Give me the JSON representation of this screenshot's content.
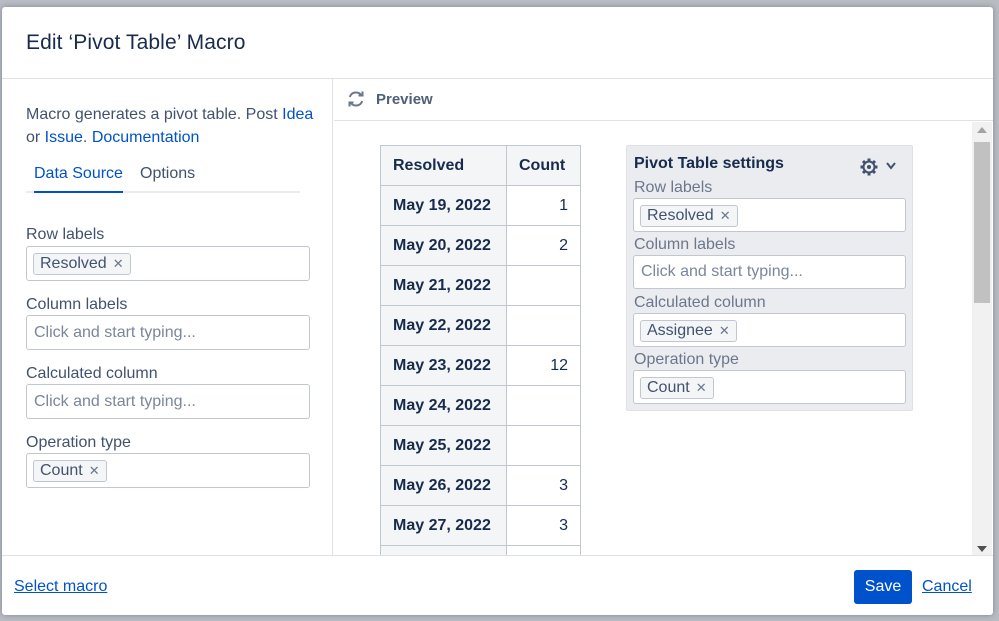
{
  "dialog": {
    "title": "Edit ‘Pivot Table’ Macro"
  },
  "left": {
    "desc_text1": "Macro generates a pivot table. Post ",
    "desc_link_idea": "Idea",
    "desc_or": "or ",
    "desc_link_issue": "Issue",
    "desc_dot": ". ",
    "desc_link_doc": "Documentation",
    "tabs": [
      "Data Source",
      "Options"
    ],
    "fields": {
      "row_labels": {
        "label": "Row labels",
        "tag": "Resolved"
      },
      "column_labels": {
        "label": "Column labels",
        "placeholder": "Click and start typing..."
      },
      "calculated_column": {
        "label": "Calculated column",
        "placeholder": "Click and start typing..."
      },
      "operation_type": {
        "label": "Operation type",
        "tag": "Count"
      }
    }
  },
  "preview": {
    "label": "Preview",
    "table": {
      "headers": [
        "Resolved",
        "Count"
      ],
      "rows": [
        {
          "date": "May 19, 2022",
          "count": "1"
        },
        {
          "date": "May 20, 2022",
          "count": "2"
        },
        {
          "date": "May 21, 2022",
          "count": ""
        },
        {
          "date": "May 22, 2022",
          "count": ""
        },
        {
          "date": "May 23, 2022",
          "count": "12"
        },
        {
          "date": "May 24, 2022",
          "count": ""
        },
        {
          "date": "May 25, 2022",
          "count": ""
        },
        {
          "date": "May 26, 2022",
          "count": "3"
        },
        {
          "date": "May 27, 2022",
          "count": "3"
        },
        {
          "date": "",
          "count": ""
        }
      ]
    },
    "settings": {
      "title": "Pivot Table settings",
      "row_labels": {
        "label": "Row labels",
        "tag": "Resolved"
      },
      "column_labels": {
        "label": "Column labels",
        "placeholder": "Click and start typing..."
      },
      "calculated_column": {
        "label": "Calculated column",
        "tag": "Assignee"
      },
      "operation_type": {
        "label": "Operation type",
        "tag": "Count"
      }
    }
  },
  "footer": {
    "select_macro": "Select macro",
    "save": "Save",
    "cancel": "Cancel"
  },
  "icons": {
    "remove": "remove-icon",
    "gear": "gear-icon",
    "chevron": "chevron-down-icon",
    "refresh": "refresh-icon"
  },
  "colors": {
    "accent": "#0052cc",
    "text": "#172b4d",
    "panel": "#ebecf0"
  }
}
